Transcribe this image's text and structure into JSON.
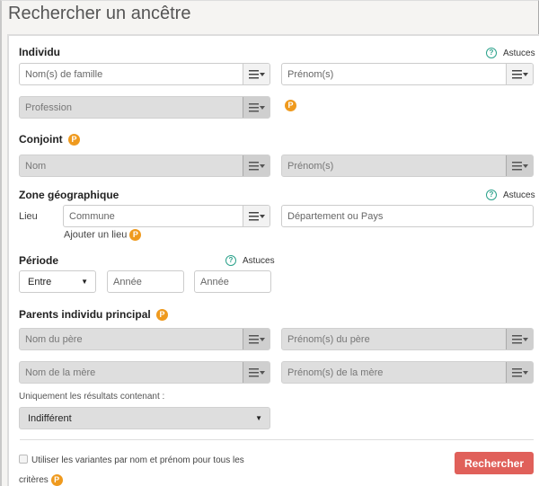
{
  "page": {
    "title": "Rechercher un ancêtre"
  },
  "colors": {
    "accent_button": "#e0605a",
    "premium_badge": "#ef9a1e",
    "help_icon": "#2aa18a"
  },
  "icons": {
    "help": "?",
    "premium": "P",
    "menu": "list-menu-icon",
    "caret": "▼"
  },
  "individu": {
    "title": "Individu",
    "astuces": "Astuces",
    "nom_placeholder": "Nom(s) de famille",
    "prenom_placeholder": "Prénom(s)",
    "profession_placeholder": "Profession"
  },
  "conjoint": {
    "title": "Conjoint",
    "nom_placeholder": "Nom",
    "prenom_placeholder": "Prénom(s)"
  },
  "zone": {
    "title": "Zone géographique",
    "astuces": "Astuces",
    "lieu_label": "Lieu",
    "commune_placeholder": "Commune",
    "departement_placeholder": "Département ou Pays",
    "add_place": "Ajouter un lieu"
  },
  "periode": {
    "title": "Période",
    "astuces": "Astuces",
    "mode_selected": "Entre",
    "annee1_placeholder": "Année",
    "annee2_placeholder": "Année"
  },
  "parents": {
    "title": "Parents individu principal",
    "pere_nom_placeholder": "Nom du père",
    "pere_prenom_placeholder": "Prénom(s) du père",
    "mere_nom_placeholder": "Nom de la mère",
    "mere_prenom_placeholder": "Prénom(s) de la mère"
  },
  "filter": {
    "label": "Uniquement les résultats contenant :",
    "selected": "Indifférent"
  },
  "variants": {
    "label_line1": "Utiliser les variantes par nom et prénom pour tous les",
    "label_line2": "critères",
    "checked": false
  },
  "actions": {
    "search_label": "Rechercher"
  }
}
